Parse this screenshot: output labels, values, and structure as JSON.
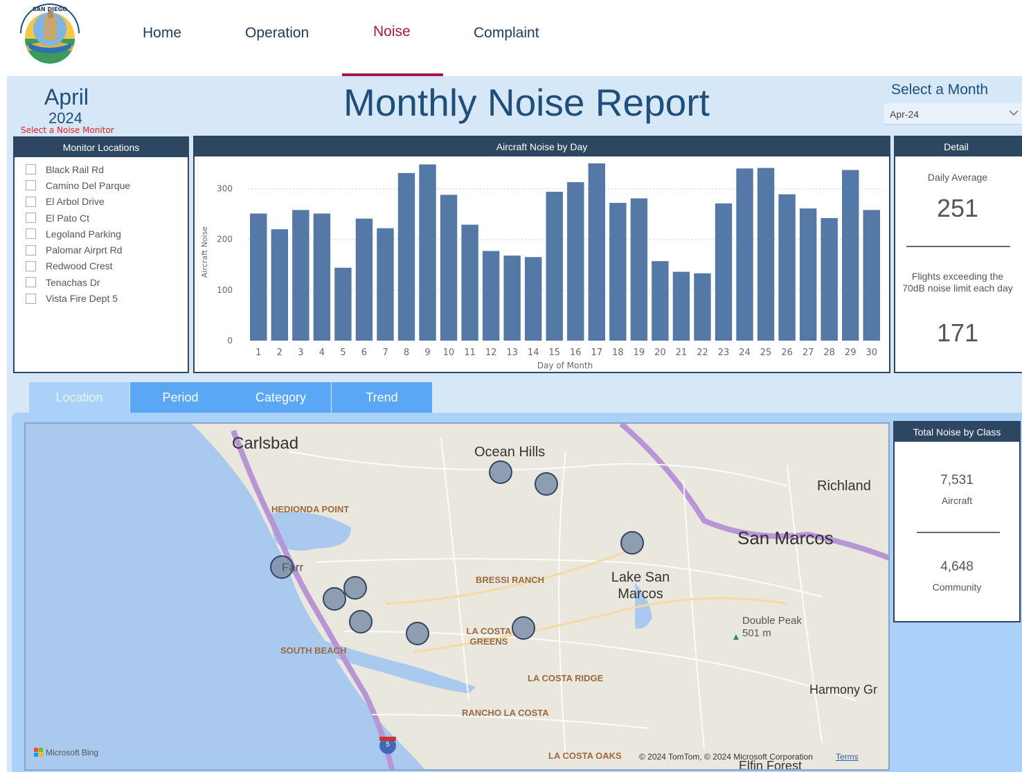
{
  "nav": {
    "items": [
      {
        "label": "Home"
      },
      {
        "label": "Operation"
      },
      {
        "label": "Noise"
      },
      {
        "label": "Complaint"
      }
    ],
    "active": "Noise"
  },
  "header": {
    "month": "April",
    "year": "2024",
    "monitor_hint": "Select a Noise Monitor",
    "title": "Monthly Noise Report",
    "select_label": "Select a Month",
    "select_value": "Apr-24"
  },
  "monitors": {
    "title": "Monitor Locations",
    "items": [
      {
        "label": "Black Rail Rd"
      },
      {
        "label": "Camino Del Parque"
      },
      {
        "label": "El Arbol Drive"
      },
      {
        "label": "El Pato Ct"
      },
      {
        "label": "Legoland Parking"
      },
      {
        "label": "Palomar Airprt Rd"
      },
      {
        "label": "Redwood Crest"
      },
      {
        "label": "Tenachas Dr"
      },
      {
        "label": "Vista Fire Dept 5"
      }
    ]
  },
  "chart_data": {
    "type": "bar",
    "title": "Aircraft Noise by Day",
    "xlabel": "Day of Month",
    "ylabel": "Aircraft Noise",
    "ylim": [
      0,
      350
    ],
    "yticks": [
      0,
      100,
      200,
      300
    ],
    "grid": true,
    "color": "#5579a6",
    "categories": [
      "1",
      "2",
      "3",
      "4",
      "5",
      "6",
      "7",
      "8",
      "9",
      "10",
      "11",
      "12",
      "13",
      "14",
      "15",
      "16",
      "17",
      "18",
      "19",
      "20",
      "21",
      "22",
      "23",
      "24",
      "25",
      "26",
      "27",
      "28",
      "29",
      "30"
    ],
    "values": [
      251,
      220,
      258,
      251,
      144,
      241,
      222,
      331,
      348,
      288,
      229,
      177,
      168,
      165,
      294,
      313,
      350,
      272,
      281,
      157,
      136,
      133,
      271,
      340,
      341,
      289,
      261,
      242,
      337,
      258
    ]
  },
  "detail": {
    "title": "Detail",
    "daily_avg_label": "Daily Average",
    "daily_avg_value": "251",
    "flights_label": "Flights exceeding the 70dB noise limit each day",
    "flights_value": "171"
  },
  "tabs": [
    {
      "label": "Location"
    },
    {
      "label": "Period"
    },
    {
      "label": "Category"
    },
    {
      "label": "Trend"
    }
  ],
  "map": {
    "places": {
      "carlsbad": "Carlsbad",
      "ocean_hills": "Ocean Hills",
      "richland": "Richland",
      "hedionda": "HEDIONDA POINT",
      "san_marcos": "San Marcos",
      "bressi": "BRESSI RANCH",
      "lake_sm": "Lake San Marcos",
      "la_costa_greens": "LA COSTA GREENS",
      "south_beach": "SOUTH BEACH",
      "double_peak": "Double Peak",
      "double_peak_elev": "501 m",
      "la_costa_ridge": "LA COSTA RIDGE",
      "harmony": "Harmony Gr",
      "rancho": "RANCHO LA COSTA",
      "la_costa_oaks": "LA COSTA OAKS",
      "elfin": "Elfin Forest",
      "farr": "Farr"
    },
    "bing": "Microsoft Bing",
    "copyright": "© 2024 TomTom, © 2024 Microsoft Corporation",
    "terms": "Terms",
    "highway": "5"
  },
  "noise_class": {
    "title": "Total Noise by Class",
    "aircraft_value": "7,531",
    "aircraft_label": "Aircraft",
    "community_value": "4,648",
    "community_label": "Community"
  }
}
